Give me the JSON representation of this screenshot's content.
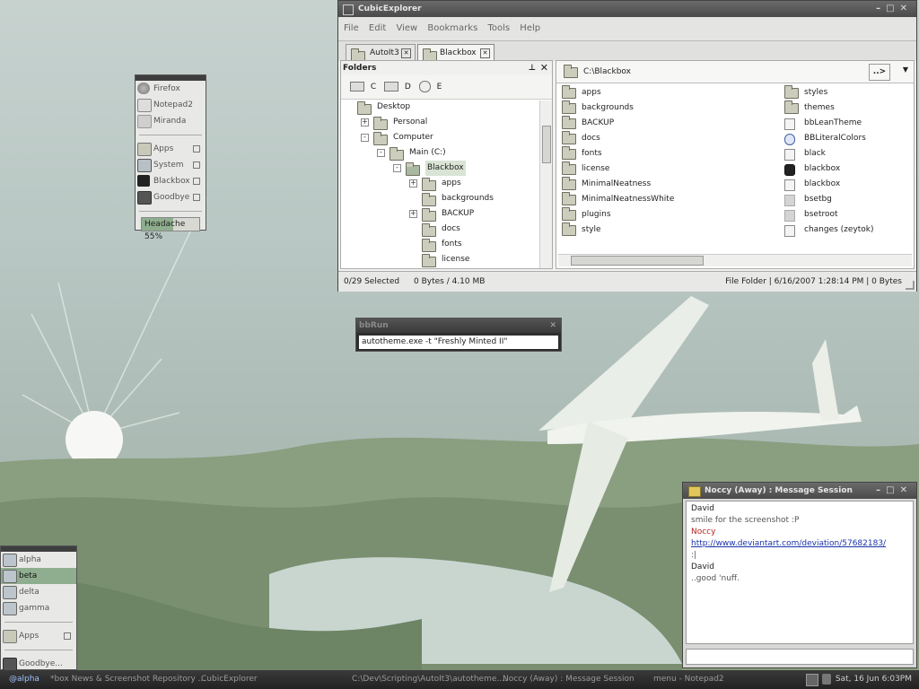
{
  "colors": {
    "accent": "#8fae8f",
    "link": "#1a33aa",
    "away_name": "#b22222"
  },
  "launcher": {
    "items": [
      {
        "label": "Firefox",
        "icon": "firefox-icon"
      },
      {
        "label": "Notepad2",
        "icon": "notepad-icon"
      },
      {
        "label": "Miranda",
        "icon": "miranda-icon"
      }
    ],
    "submenus": [
      {
        "label": "Apps",
        "icon": "folder-icon"
      },
      {
        "label": "System",
        "icon": "computer-icon"
      },
      {
        "label": "Blackbox",
        "icon": "blackbox-icon"
      },
      {
        "label": "Goodbye",
        "icon": "shutdown-icon"
      }
    ],
    "meter_label": "Headache 55%",
    "meter_value": 0.55
  },
  "explorer": {
    "title": "CubicExplorer",
    "menu": [
      "File",
      "Edit",
      "View",
      "Bookmarks",
      "Tools",
      "Help"
    ],
    "tabs": [
      {
        "label": "AutoIt3"
      },
      {
        "label": "Blackbox"
      }
    ],
    "folders_label": "Folders",
    "drives": [
      "C",
      "D",
      "E"
    ],
    "tree": [
      {
        "label": "Desktop",
        "indent": 0,
        "exp": ""
      },
      {
        "label": "Personal",
        "indent": 1,
        "exp": "+"
      },
      {
        "label": "Computer",
        "indent": 1,
        "exp": "-"
      },
      {
        "label": "Main (C:)",
        "indent": 2,
        "exp": "-"
      },
      {
        "label": "Blackbox",
        "indent": 3,
        "exp": "-"
      },
      {
        "label": "apps",
        "indent": 4,
        "exp": "+"
      },
      {
        "label": "backgrounds",
        "indent": 4,
        "exp": ""
      },
      {
        "label": "BACKUP",
        "indent": 4,
        "exp": "+"
      },
      {
        "label": "docs",
        "indent": 4,
        "exp": ""
      },
      {
        "label": "fonts",
        "indent": 4,
        "exp": ""
      },
      {
        "label": "license",
        "indent": 4,
        "exp": ""
      }
    ],
    "address": "C:\\Blackbox",
    "go_label": "..>",
    "files_col1": [
      "apps",
      "backgrounds",
      "BACKUP",
      "docs",
      "fonts",
      "license",
      "MinimalNeatness",
      "MinimalNeatnessWhite",
      "plugins",
      "style"
    ],
    "files_col2": [
      {
        "label": "styles",
        "icon": "folder-icon"
      },
      {
        "label": "themes",
        "icon": "folder-icon"
      },
      {
        "label": "bbLeanTheme",
        "icon": "script-file-icon"
      },
      {
        "label": "BBLiteralColors",
        "icon": "colors-file-icon"
      },
      {
        "label": "black",
        "icon": "file-icon"
      },
      {
        "label": "blackbox",
        "icon": "blackbox-exe-icon"
      },
      {
        "label": "blackbox",
        "icon": "script-file-icon"
      },
      {
        "label": "bsetbg",
        "icon": "cube-icon"
      },
      {
        "label": "bsetroot",
        "icon": "cube-icon"
      },
      {
        "label": "changes (zeytok)",
        "icon": "file-icon"
      }
    ],
    "status_left": "0/29 Selected",
    "status_mid": "0 Bytes / 4.10 MB",
    "status_right": "File Folder | 6/16/2007 1:28:14 PM | 0 Bytes"
  },
  "bbrun": {
    "title": "bbRun",
    "command": "autotheme.exe -t \"Freshly Minted II\""
  },
  "workspaces": {
    "items": [
      "alpha",
      "beta",
      "delta",
      "gamma"
    ],
    "active": "beta",
    "apps_label": "Apps",
    "goodbye_label": "Goodbye..."
  },
  "chat": {
    "title": "Noccy (Away) : Message Session",
    "lines": [
      {
        "text": "David",
        "style": "name"
      },
      {
        "text": "smile for the screenshot :P",
        "style": "msg"
      },
      {
        "text": "Noccy",
        "style": "away"
      },
      {
        "text": "http://www.deviantart.com/deviation/57682183/",
        "style": "link"
      },
      {
        "text": ":|",
        "style": "msg"
      },
      {
        "text": "David",
        "style": "name"
      },
      {
        "text": "..good 'nuff.",
        "style": "msg"
      }
    ]
  },
  "taskbar": {
    "workspace": "@alpha",
    "tasks": [
      "*box News & Screenshot Repository ...",
      "CubicExplorer",
      "C:\\Dev\\Scripting\\AutoIt3\\autotheme....",
      "Noccy (Away) : Message Session",
      "menu - Notepad2"
    ],
    "clock": "Sat, 16 Jun 6:03PM"
  }
}
